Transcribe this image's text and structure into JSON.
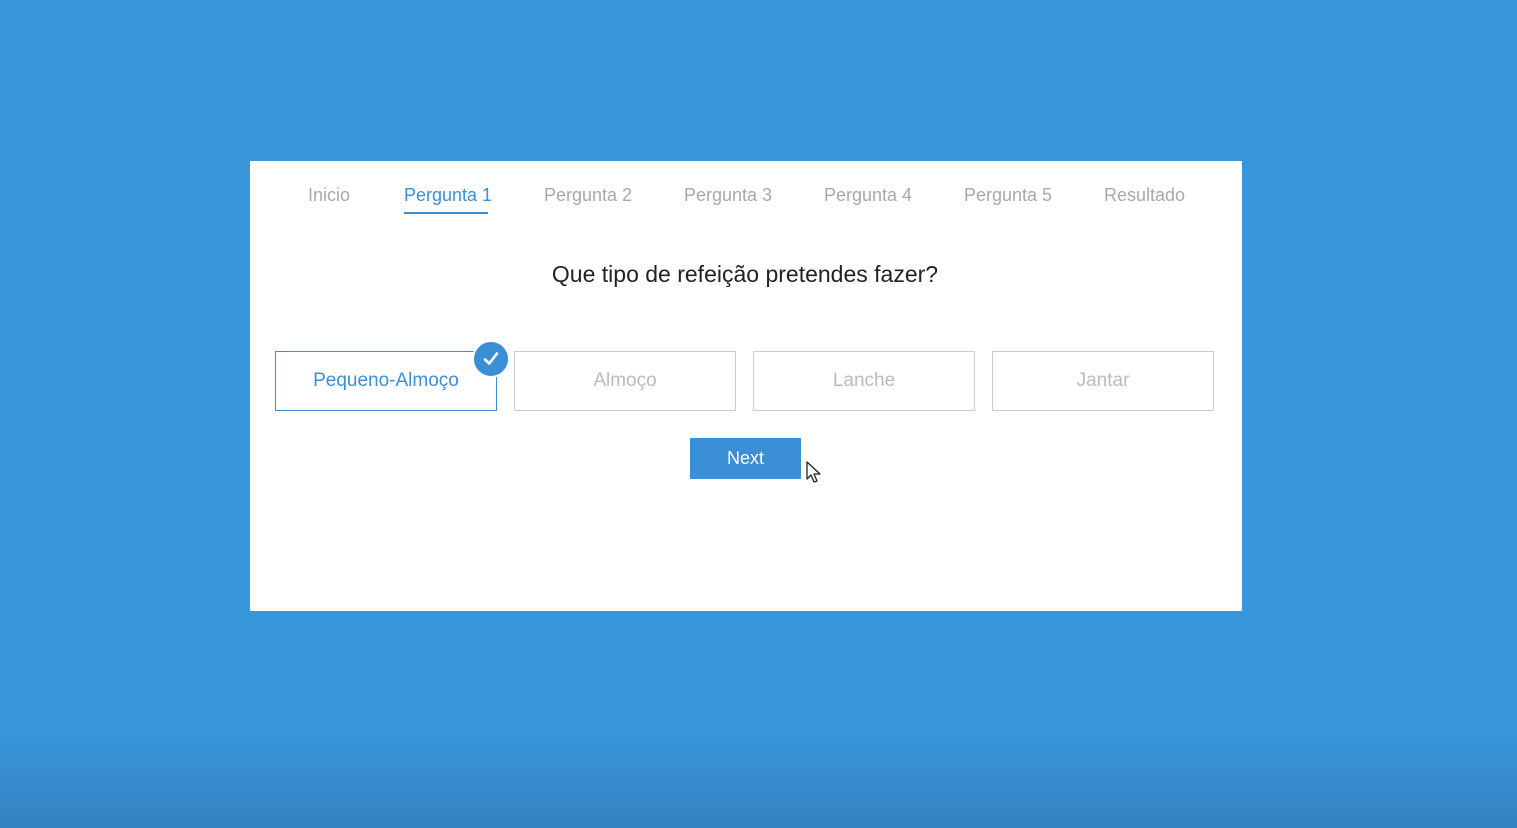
{
  "tabs": [
    {
      "label": "Inicio",
      "active": false
    },
    {
      "label": "Pergunta 1",
      "active": true
    },
    {
      "label": "Pergunta 2",
      "active": false
    },
    {
      "label": "Pergunta 3",
      "active": false
    },
    {
      "label": "Pergunta 4",
      "active": false
    },
    {
      "label": "Pergunta 5",
      "active": false
    },
    {
      "label": "Resultado",
      "active": false
    }
  ],
  "question": "Que tipo de refeição pretendes fazer?",
  "options": [
    {
      "label": "Pequeno-Almoço",
      "selected": true
    },
    {
      "label": "Almoço",
      "selected": false
    },
    {
      "label": "Lanche",
      "selected": false
    },
    {
      "label": "Jantar",
      "selected": false
    }
  ],
  "next_button": {
    "label": "Next"
  },
  "icons": {
    "selected_check": "check-icon",
    "mouse": "mouse-cursor-icon"
  },
  "colors": {
    "background": "#3897db",
    "accent": "#3a8fd6",
    "card": "#ffffff",
    "inactive_text": "#a9a9a9"
  }
}
